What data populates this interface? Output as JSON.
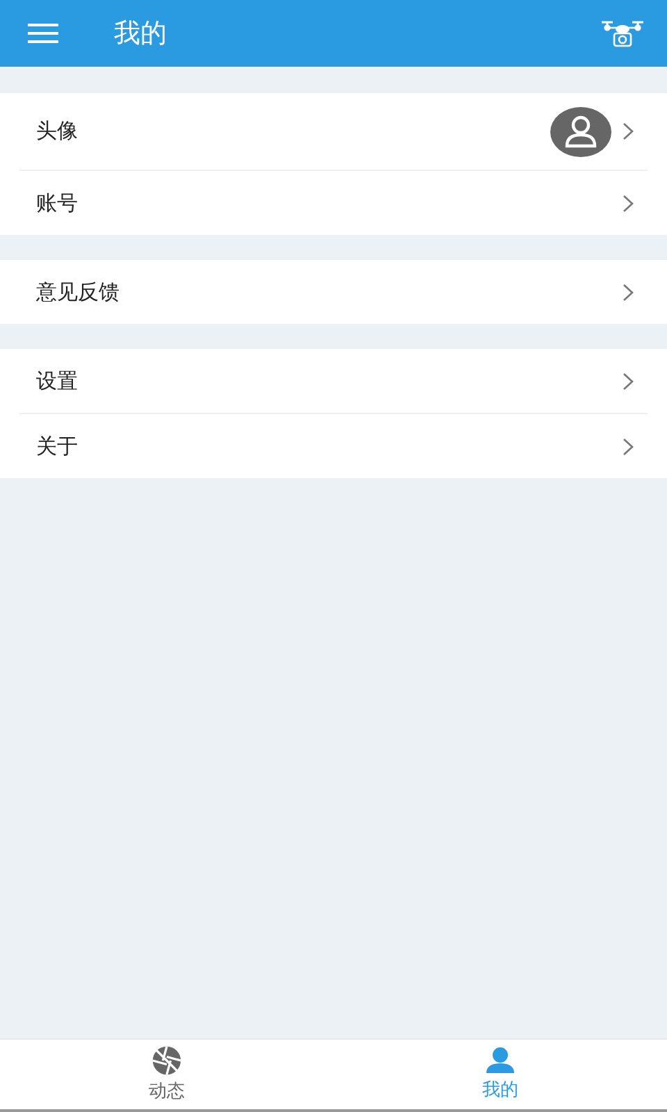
{
  "header": {
    "title": "我的"
  },
  "sections": [
    {
      "rows": [
        {
          "kind": "avatar",
          "label": "头像"
        },
        {
          "kind": "plain",
          "label": "账号"
        }
      ]
    },
    {
      "rows": [
        {
          "kind": "plain",
          "label": "意见反馈"
        }
      ]
    },
    {
      "rows": [
        {
          "kind": "plain",
          "label": "设置"
        },
        {
          "kind": "plain",
          "label": "关于"
        }
      ]
    }
  ],
  "tabs": [
    {
      "label": "动态",
      "kind": "aperture",
      "selected": false
    },
    {
      "label": "我的",
      "kind": "person",
      "selected": true
    }
  ]
}
